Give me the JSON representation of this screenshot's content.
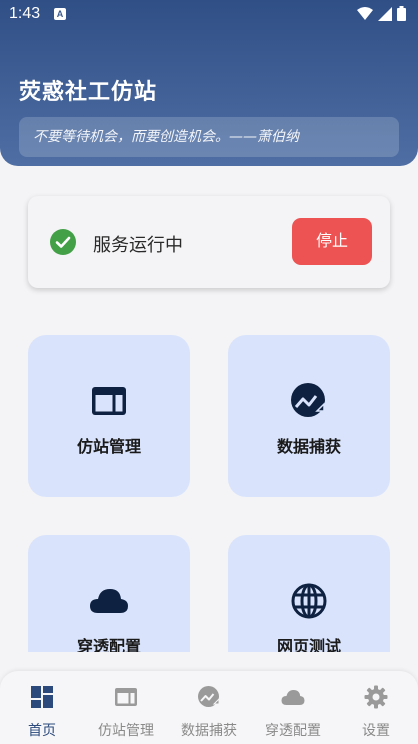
{
  "status_bar": {
    "time": "1:43",
    "notification_badge": "A"
  },
  "header": {
    "title": "荧惑社工仿站",
    "quote": "不要等待机会，而要创造机会。——萧伯纳"
  },
  "service": {
    "status_text": "服务运行中",
    "stop_label": "停止",
    "status_color": "#43a047"
  },
  "tiles": [
    {
      "label": "仿站管理",
      "icon": "browser-window-icon"
    },
    {
      "label": "数据捕获",
      "icon": "chart-trend-icon"
    },
    {
      "label": "穿透配置",
      "icon": "cloud-icon"
    },
    {
      "label": "网页测试",
      "icon": "globe-icon"
    }
  ],
  "nav": [
    {
      "label": "首页",
      "icon": "dashboard-icon",
      "active": true
    },
    {
      "label": "仿站管理",
      "icon": "browser-window-icon"
    },
    {
      "label": "数据捕获",
      "icon": "chart-trend-icon"
    },
    {
      "label": "穿透配置",
      "icon": "cloud-icon"
    },
    {
      "label": "设置",
      "icon": "gear-icon"
    }
  ],
  "colors": {
    "primary": "#2f4f86",
    "tile_bg": "#d9e4fc",
    "stop": "#ec5352",
    "icon_dark": "#0f2140"
  }
}
